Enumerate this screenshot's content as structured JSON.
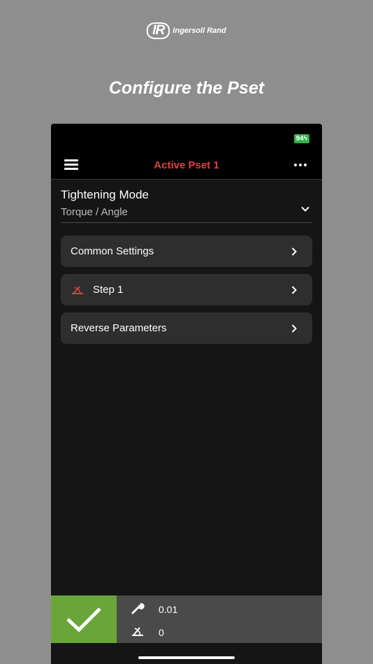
{
  "branding": {
    "logo_mark": "IR",
    "logo_name": "Ingersoll Rand"
  },
  "headline": "Configure the Pset",
  "status_bar": {
    "battery": "94"
  },
  "app_bar": {
    "title": "Active Pset 1",
    "title_color": "#e0413a"
  },
  "tightening_mode": {
    "label": "Tightening Mode",
    "value": "Torque / Angle"
  },
  "menu_items": [
    {
      "label": "Common Settings"
    },
    {
      "label": "Step 1"
    },
    {
      "label": "Reverse Parameters"
    }
  ],
  "readouts": {
    "torque": "0.01",
    "angle": "0"
  },
  "colors": {
    "confirm": "#6aa539",
    "accent": "#e0413a",
    "battery": "#2fb24a"
  }
}
